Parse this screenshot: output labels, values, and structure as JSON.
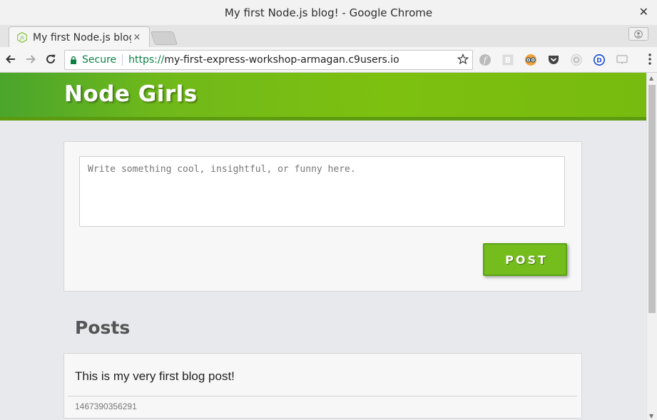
{
  "window": {
    "title": "My first Node.js blog! - Google Chrome",
    "close_glyph": "✕"
  },
  "tab": {
    "title": "My first Node.js blog",
    "favicon": "nodejs-icon",
    "close_glyph": "×"
  },
  "address_bar": {
    "secure_label": "Secure",
    "scheme": "https://",
    "host": "my-first-express-workshop-armagan.c9users.io"
  },
  "extensions": [
    "fedora-icon",
    "b-icon",
    "owl-icon",
    "pocket-icon",
    "gear-icon",
    "d-icon",
    "comment-icon"
  ],
  "site": {
    "brand": "Node Girls",
    "composer": {
      "placeholder": "Write something cool, insightful, or funny here.",
      "value": "",
      "post_button": "POST"
    },
    "posts_heading": "Posts",
    "posts": [
      {
        "text": "This is my very first blog post!",
        "timestamp": "1467390356291"
      }
    ]
  },
  "colors": {
    "brand_green": "#7dc010",
    "secure_green": "#0b8043",
    "button_green": "#74bd1c"
  }
}
